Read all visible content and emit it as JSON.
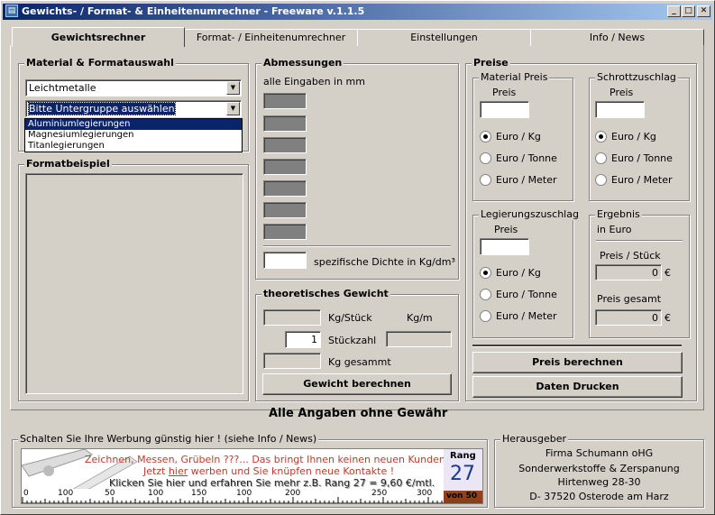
{
  "window": {
    "title": "Gewichts- / Format- & Einheitenumrechner - Freeware v.1.1.5",
    "minimize_glyph": "_",
    "maximize_glyph": "□",
    "close_glyph": "✕"
  },
  "tabs": [
    "Gewichtsrechner",
    "Format- / Einheitenumrechner",
    "Einstellungen",
    "Info / News"
  ],
  "material": {
    "title": "Material & Formatauswahl",
    "material_value": "Leichtmetalle",
    "subgroup_value": "Bitte Untergruppe auswählen",
    "subgroup_options": [
      "Aluminiumlegierungen",
      "Magnesiumlegierungen",
      "Titanlegierungen"
    ],
    "format_title": "Formatbeispiel"
  },
  "dimensions": {
    "title": "Abmessungen",
    "note": "alle Eingaben in mm",
    "density_label": "spezifische Dichte in Kg/dm³"
  },
  "weight": {
    "title": "theoretisches Gewicht",
    "kg_per_piece": "Kg/Stück",
    "kg_per_m": "Kg/m",
    "quantity_label": "Stückzahl",
    "quantity_value": "1",
    "total_label": "Kg gesammt",
    "button": "Gewicht berechnen"
  },
  "prices": {
    "title": "Preise",
    "material": {
      "title": "Material Preis",
      "price_label": "Preis"
    },
    "scrap": {
      "title": "Schrottzuschlag",
      "price_label": "Preis"
    },
    "alloy": {
      "title": "Legierungszuschlag",
      "price_label": "Preis"
    },
    "units": [
      "Euro / Kg",
      "Euro / Tonne",
      "Euro / Meter"
    ],
    "result": {
      "title": "Ergebnis",
      "currency_note": "in Euro",
      "per_piece_label": "Preis / Stück",
      "per_piece_value": "0",
      "total_label": "Preis gesamt",
      "total_value": "0",
      "euro_sign": "€"
    },
    "calc_button": "Preis berechnen",
    "print_button": "Daten Drucken"
  },
  "disclaimer": "Alle Angaben ohne Gewähr",
  "advert": {
    "title": "Schalten Sie Ihre Werbung günstig hier ! (siehe Info / News)",
    "line1": "Zeichnen, Messen, Grübeln ???... Das bringt Ihnen keinen neuen Kunden.",
    "line2_pre": "Jetzt ",
    "line2_link": "hier",
    "line2_post": " werben und Sie knüpfen neue Kontakte !",
    "line3": "Klicken Sie hier und erfahren Sie mehr   z.B. Rang 27 = 9,60 €/mtl.",
    "rank_label": "Rang",
    "rank_value": "27",
    "rank_of": "von 50",
    "ruler_labels": [
      "0",
      "100",
      "50",
      "100",
      "150",
      "100",
      "200",
      "250",
      "300"
    ]
  },
  "publisher": {
    "title": "Herausgeber",
    "lines": [
      "Firma Schumann oHG",
      "Sonderwerkstoffe & Zerspanung",
      "Hirtenweg 28-30",
      "D- 37520 Osterode am Harz"
    ]
  }
}
